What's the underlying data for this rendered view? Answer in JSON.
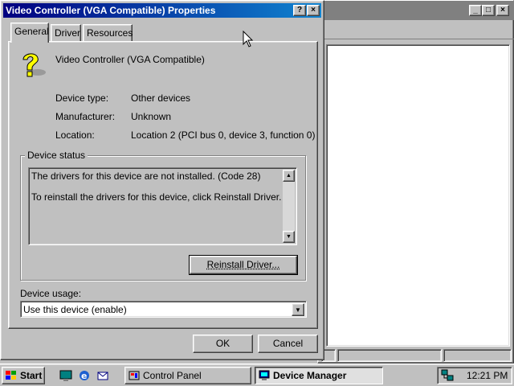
{
  "dialog": {
    "title": "Video Controller (VGA Compatible) Properties",
    "tabs": [
      {
        "label": "General",
        "active": true
      },
      {
        "label": "Driver",
        "active": false
      },
      {
        "label": "Resources",
        "active": false
      }
    ],
    "device_name": "Video Controller (VGA Compatible)",
    "device_icon": "unknown-device-question-icon",
    "props": {
      "device_type_label": "Device type:",
      "device_type_value": "Other devices",
      "manufacturer_label": "Manufacturer:",
      "manufacturer_value": "Unknown",
      "location_label": "Location:",
      "location_value": "Location 2 (PCI bus 0, device 3, function 0)"
    },
    "device_status": {
      "legend": "Device status",
      "line1": "The drivers for this device are not installed. (Code 28)",
      "line2": "To reinstall the drivers for this device, click Reinstall Driver."
    },
    "reinstall_button": "Reinstall Driver...",
    "usage": {
      "label": "Device usage:",
      "selected": "Use this device (enable)"
    },
    "ok_label": "OK",
    "cancel_label": "Cancel",
    "help_glyph": "?",
    "close_glyph": "×"
  },
  "background_window": {
    "minimize_glyph": "_",
    "maximize_glyph": "□",
    "close_glyph": "×"
  },
  "taskbar": {
    "start_label": "Start",
    "tasks": [
      {
        "label": "Control Panel",
        "icon": "control-panel-icon",
        "pressed": false
      },
      {
        "label": "Device Manager",
        "icon": "device-manager-icon",
        "pressed": true
      }
    ],
    "quick_launch": [
      "show-desktop-icon",
      "internet-explorer-icon",
      "outlook-express-icon"
    ],
    "tray_icon": "network-icon",
    "clock": "12:21 PM"
  },
  "colors": {
    "title_active_start": "#000080",
    "title_active_end": "#1084d0",
    "title_inactive": "#808080",
    "face": "#c0c0c0"
  }
}
